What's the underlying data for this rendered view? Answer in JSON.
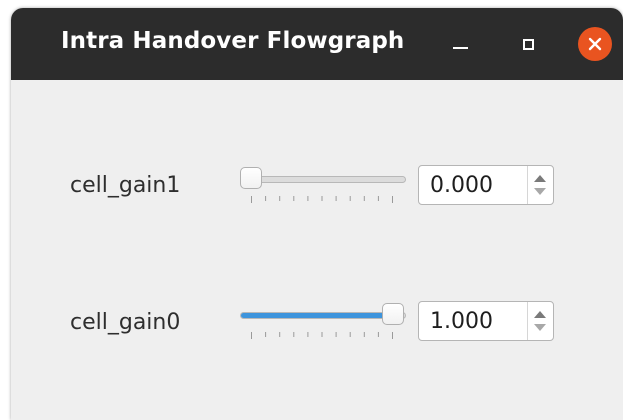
{
  "window": {
    "title": "Intra Handover Flowgraph",
    "controls": {
      "minimize": "minimize-icon",
      "maximize": "maximize-icon",
      "close": "close-icon"
    },
    "close_color": "#e95420",
    "titlebar_color": "#2c2c2c"
  },
  "controls": [
    {
      "label": "cell_gain1",
      "slider_level": 0.0,
      "value": "0.000"
    },
    {
      "label": "cell_gain0",
      "slider_level": 1.0,
      "value": "1.000"
    }
  ],
  "accent_color": "#3d94dc",
  "icons": {
    "spin_up": "chevron-up-icon",
    "spin_down": "chevron-down-icon"
  }
}
